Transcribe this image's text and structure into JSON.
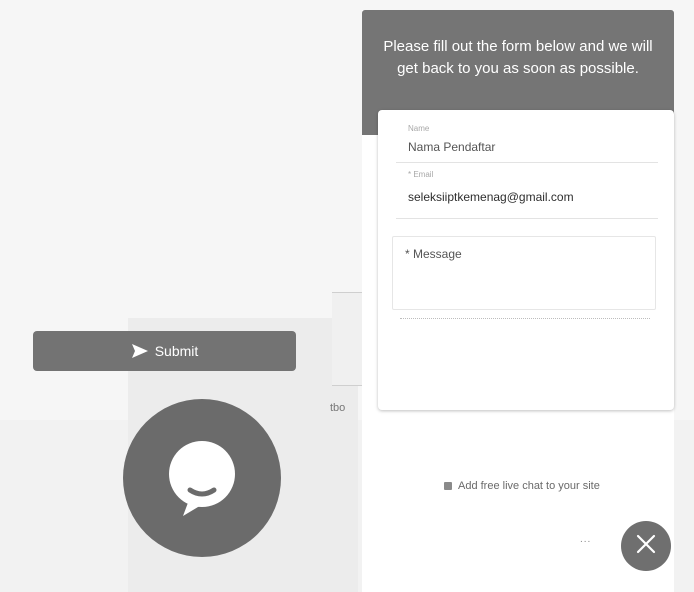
{
  "widget": {
    "header_text": "Please fill out the form below and we will get back to you as soon as possible.",
    "form": {
      "name_label": "Name",
      "name_value": "Nama Pendaftar",
      "email_label": "* Email",
      "email_value": "seleksiiptkemenag@gmail.com",
      "message_placeholder": "* Message",
      "submit_label": "Submit"
    },
    "footer_link": "Add free live chat to your site",
    "more_indicator": "..."
  },
  "background": {
    "fragment_text": "tbo"
  },
  "icons": {
    "launcher": "chat-bubble-icon",
    "submit": "send-icon",
    "close": "close-icon",
    "footer": "hand-icon"
  },
  "colors": {
    "header_bg": "#757575",
    "button_bg": "#737373",
    "launcher_bg": "#6b6b6b",
    "close_bg": "#6f6f6f"
  }
}
